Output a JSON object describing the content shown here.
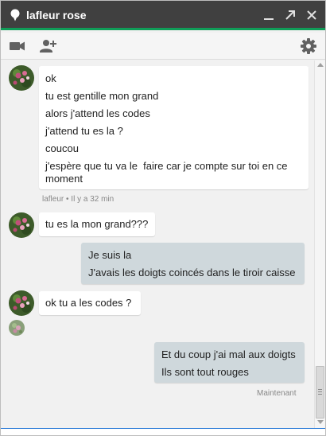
{
  "window": {
    "title": "lafleur rose",
    "accent_color": "#0f9d58",
    "titlebar_color": "#404040"
  },
  "titlebar": {
    "minimize_icon": "minimize-icon",
    "popout_icon": "popout-icon",
    "close_icon": "close-icon"
  },
  "toolbar": {
    "video_icon": "video-camera-icon",
    "add_user_icon": "add-person-icon",
    "settings_icon": "gear-icon"
  },
  "messages": {
    "group1": {
      "lines": [
        "ok",
        "tu est gentille mon grand",
        "alors j'attend les codes",
        "j'attend tu es la ?",
        "coucou",
        "j'espère que tu va le  faire car je compte sur toi en ce moment"
      ],
      "meta": "lafleur • Il y a 32 min"
    },
    "group2": {
      "lines": [
        "tu es la mon grand???"
      ]
    },
    "group3": {
      "lines": [
        "Je suis la",
        "J'avais les doigts coincés dans le tiroir caisse"
      ]
    },
    "group4": {
      "lines": [
        "ok tu a les codes ?"
      ]
    },
    "group5": {
      "lines": [
        "Et du coup j'ai mal aux doigts",
        "Ils sont tout rouges"
      ],
      "meta": "Maintenant"
    }
  }
}
